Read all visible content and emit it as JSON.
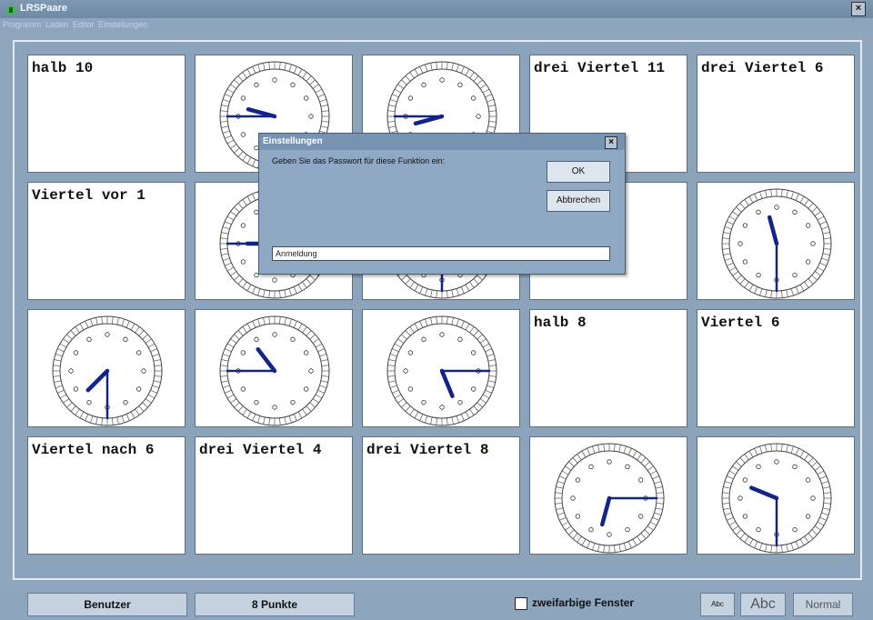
{
  "window": {
    "title": "LRSPaare",
    "close": "×"
  },
  "menu": [
    "Programm",
    "Laden",
    "Editor",
    "Einstellungen"
  ],
  "cards": [
    {
      "type": "text",
      "text": "halb 10"
    },
    {
      "type": "clock",
      "hour": 9.5,
      "minute": 45
    },
    {
      "type": "clock",
      "hour": 8.5,
      "minute": 45
    },
    {
      "type": "text",
      "text": "drei Viertel 11"
    },
    {
      "type": "text",
      "text": "drei Viertel 6"
    },
    {
      "type": "text",
      "text": "Viertel vor 1"
    },
    {
      "type": "clock",
      "hour": 9,
      "minute": 45
    },
    {
      "type": "clock",
      "hour": 5.5,
      "minute": 30
    },
    {
      "type": "text",
      "text": ""
    },
    {
      "type": "clock",
      "hour": 11.5,
      "minute": 30
    },
    {
      "type": "clock",
      "hour": 7.5,
      "minute": 30
    },
    {
      "type": "clock",
      "hour": 10.75,
      "minute": 45
    },
    {
      "type": "clock",
      "hour": 5.25,
      "minute": 15
    },
    {
      "type": "text",
      "text": "halb 8"
    },
    {
      "type": "text",
      "text": "Viertel 6"
    },
    {
      "type": "text",
      "text": "Viertel nach 6"
    },
    {
      "type": "text",
      "text": "drei Viertel 4"
    },
    {
      "type": "text",
      "text": "drei Viertel 8"
    },
    {
      "type": "clock",
      "hour": 6.5,
      "minute": 15
    },
    {
      "type": "clock",
      "hour": 9.75,
      "minute": 30
    }
  ],
  "bottom": {
    "user_button": "Benutzer",
    "points": "8 Punkte",
    "two_color_label": "zweifarbige Fenster",
    "font_small": "Abc",
    "font_large": "Abc",
    "mode": "Normal"
  },
  "dialog": {
    "title": "Einstellungen",
    "close": "×",
    "message": "Geben Sie das Passwort für diese Funktion ein:",
    "ok": "OK",
    "cancel": "Abbrechen",
    "input_value": "Anmeldung"
  },
  "colors": {
    "hand": "#12238a",
    "background": "#8fa6bc"
  }
}
